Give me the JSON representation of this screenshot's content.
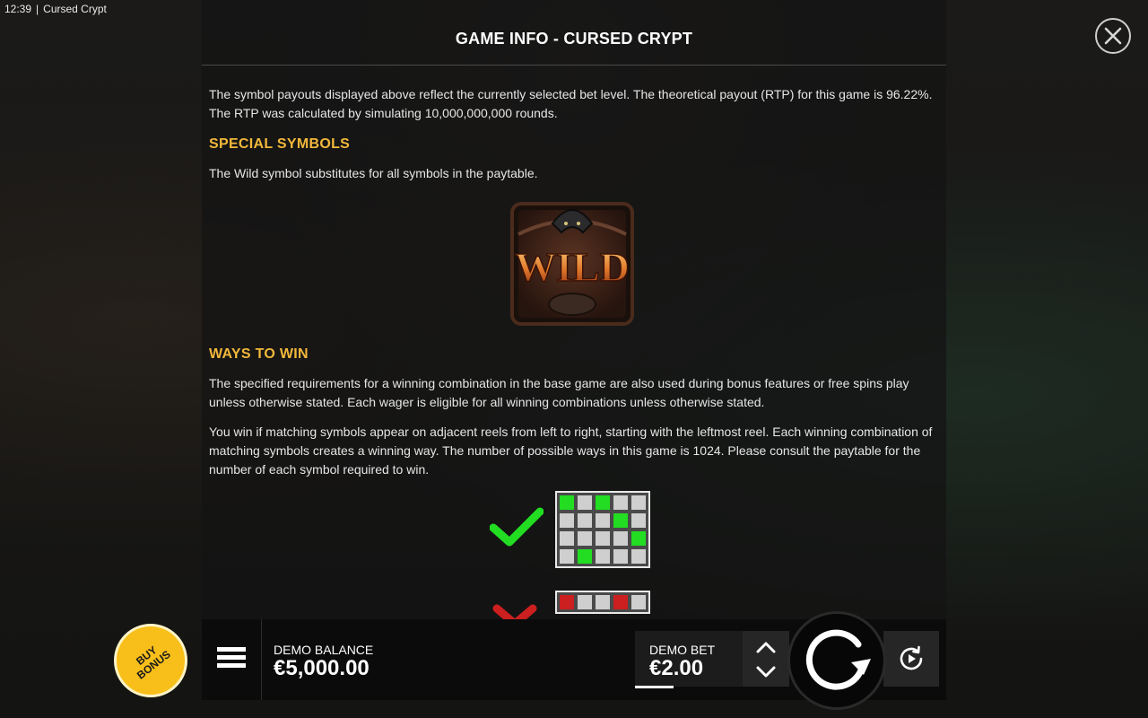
{
  "system": {
    "time": "12:39",
    "separator": "|",
    "window_title": "Cursed Crypt"
  },
  "panel": {
    "title": "GAME INFO - CURSED CRYPT",
    "rtp_text": "The symbol payouts displayed above reflect the currently selected bet level. The theoretical payout (RTP) for this game is 96.22%. The RTP was calculated by simulating 10,000,000,000 rounds.",
    "special_symbols": {
      "heading": "SPECIAL SYMBOLS",
      "text": "The Wild symbol substitutes for all symbols in the paytable.",
      "wild_label": "WILD"
    },
    "ways_to_win": {
      "heading": "WAYS TO WIN",
      "p1": "The specified requirements for a winning combination in the base game are also used during bonus features or free spins play unless otherwise stated. Each wager is eligible for all winning combinations unless otherwise stated.",
      "p2": "You win if matching symbols appear on adjacent reels from left to right, starting with the leftmost reel. Each winning combination of matching symbols creates a winning way. The number of possible ways in this game is 1024. Please consult the paytable for the number of each symbol required to win.",
      "valid_grid": [
        [
          1,
          0,
          1,
          0,
          0
        ],
        [
          0,
          0,
          0,
          1,
          0
        ],
        [
          0,
          0,
          0,
          0,
          1
        ],
        [
          0,
          1,
          0,
          0,
          0
        ]
      ],
      "invalid_grid_top_row": [
        1,
        0,
        0,
        1,
        0
      ]
    },
    "scrollbar_position": 0.45
  },
  "footer": {
    "buy_bonus_line1": "BUY",
    "buy_bonus_line2": "BONUS",
    "balance_label": "DEMO BALANCE",
    "balance_value": "€5,000.00",
    "bet_label": "DEMO BET",
    "bet_value": "€2.00"
  },
  "colors": {
    "accent": "#f2b83b",
    "win_cell": "#22dd22",
    "lose_cell": "#cc1f1f",
    "buy_bonus": "#f8bf1b"
  },
  "icons": {
    "close": "close-icon",
    "menu": "hamburger-icon",
    "spin": "spin-icon",
    "autoplay": "autoplay-icon",
    "check": "checkmark-icon",
    "cross": "cross-icon"
  }
}
